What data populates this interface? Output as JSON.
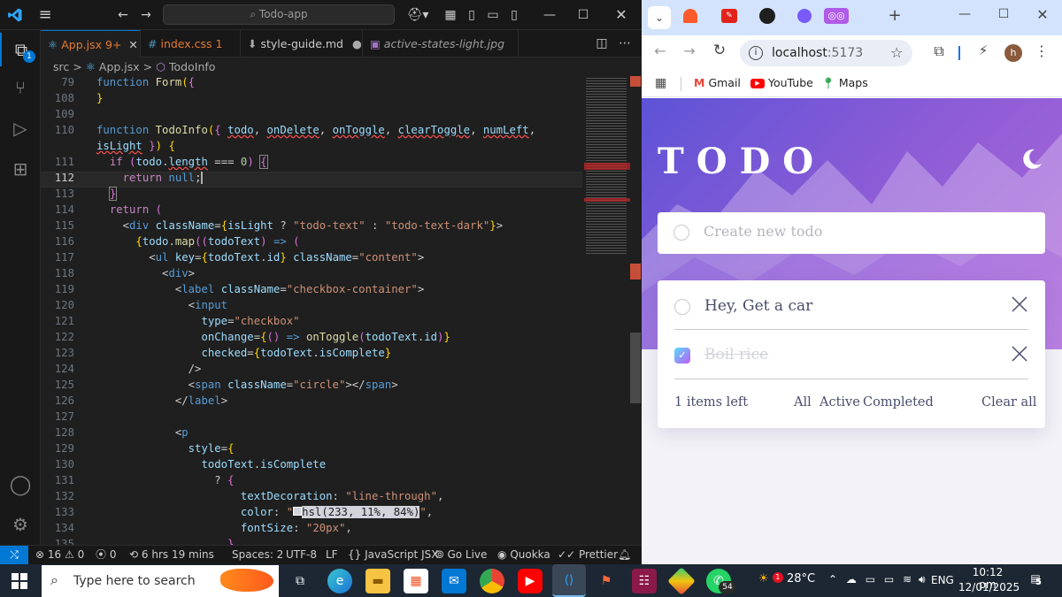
{
  "vscode": {
    "search_text": "Todo-app",
    "tabs": [
      {
        "icon": "react-icon",
        "label": "App.jsx",
        "badge": "9+",
        "active": true
      },
      {
        "icon": "hash-icon",
        "label": "index.css",
        "badge": "1",
        "active": false
      },
      {
        "icon": "download-icon",
        "label": "style-guide.md",
        "badge": "●",
        "active": false
      },
      {
        "icon": "image-icon",
        "label": "active-states-light.jpg",
        "badge": "",
        "active": false
      }
    ],
    "breadcrumb": [
      "src",
      "App.jsx",
      "TodoInfo"
    ],
    "accounts_badge": "1",
    "line_numbers": [
      "79",
      "108",
      "109",
      "110",
      "",
      "111",
      "112",
      "113",
      "114",
      "115",
      "116",
      "117",
      "118",
      "119",
      "120",
      "121",
      "122",
      "123",
      "124",
      "125",
      "126",
      "127",
      "128",
      "129",
      "130",
      "131",
      "132",
      "133",
      "134",
      "135"
    ],
    "status": {
      "errors": "16",
      "warnings": "0",
      "ports": "0",
      "time": "6 hrs 19 mins",
      "spaces": "Spaces: 2",
      "encoding": "UTF-8",
      "eol": "LF",
      "language": "JavaScript JSX",
      "golive": "Go Live",
      "quokka": "Quokka",
      "prettier": "Prettier"
    }
  },
  "chrome": {
    "url_host": "localhost",
    "url_port": ":5173",
    "profile_initial": "h",
    "bookmarks": [
      "Gmail",
      "YouTube",
      "Maps"
    ]
  },
  "todo_app": {
    "title": "TODO",
    "new_placeholder": "Create new todo",
    "items": [
      {
        "text": "Hey, Get a car",
        "completed": false
      },
      {
        "text": "Boil rice",
        "completed": true
      }
    ],
    "items_left": "1 items left",
    "filters": [
      "All",
      "Active",
      "Completed"
    ],
    "clear_label": "Clear all"
  },
  "taskbar": {
    "search_placeholder": "Type here to search",
    "whatsapp_badge": "54",
    "weather_badge": "1",
    "temperature": "28°C",
    "language": "ENG",
    "time": "10:12 pm",
    "date": "12/01/2025",
    "notifications": "5"
  },
  "colors": {
    "vscode_bg": "#1f1f1f",
    "accent": "#0078d4",
    "todo_gradient_start": "#5d53d6",
    "todo_gradient_end": "#b06ad9",
    "check_gradient": "#a77bf3"
  }
}
